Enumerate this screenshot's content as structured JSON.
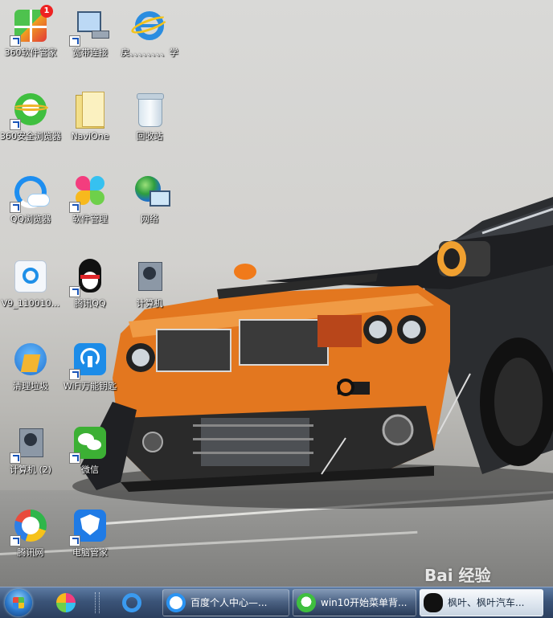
{
  "desktop": {
    "icons": [
      {
        "label": "360软件管家",
        "icon": "app-grid-icon"
      },
      {
        "label": "宽带连接",
        "icon": "network-connection-icon"
      },
      {
        "label": "戻、、、、、、、、学",
        "icon": "internet-explorer-icon"
      },
      {
        "label": "360安全浏览器",
        "icon": "browser-360-icon"
      },
      {
        "label": "NaviOne",
        "icon": "folder-icon"
      },
      {
        "label": "回收站",
        "icon": "recycle-bin-icon"
      },
      {
        "label": "QQ浏览器",
        "icon": "qq-browser-icon"
      },
      {
        "label": "软件管理",
        "icon": "software-manager-icon"
      },
      {
        "label": "网络",
        "icon": "network-globe-icon"
      },
      {
        "label": "V9_110010...",
        "icon": "installer-icon"
      },
      {
        "label": "腾讯QQ",
        "icon": "qq-penguin-icon"
      },
      {
        "label": "计算机",
        "icon": "computer-icon"
      },
      {
        "label": "清理垃圾",
        "icon": "broom-icon"
      },
      {
        "label": "WiFi万能钥匙",
        "icon": "wifi-key-icon"
      },
      {
        "label": "计算机 (2)",
        "icon": "computer-icon"
      },
      {
        "label": "微信",
        "icon": "wechat-icon"
      },
      {
        "label": "腾讯网",
        "icon": "tencent-news-icon"
      },
      {
        "label": "电脑管家",
        "icon": "pc-manager-icon"
      }
    ],
    "badge": "1"
  },
  "taskbar": {
    "buttons": [
      {
        "label": "百度个人中心—...",
        "icon": "qq-browser-icon"
      },
      {
        "label": "win10开始菜单背...",
        "icon": "browser-360-icon"
      },
      {
        "label": "枫叶、枫叶汽车...",
        "icon": "qq-penguin-icon"
      }
    ]
  },
  "watermark": "Bai 经验"
}
